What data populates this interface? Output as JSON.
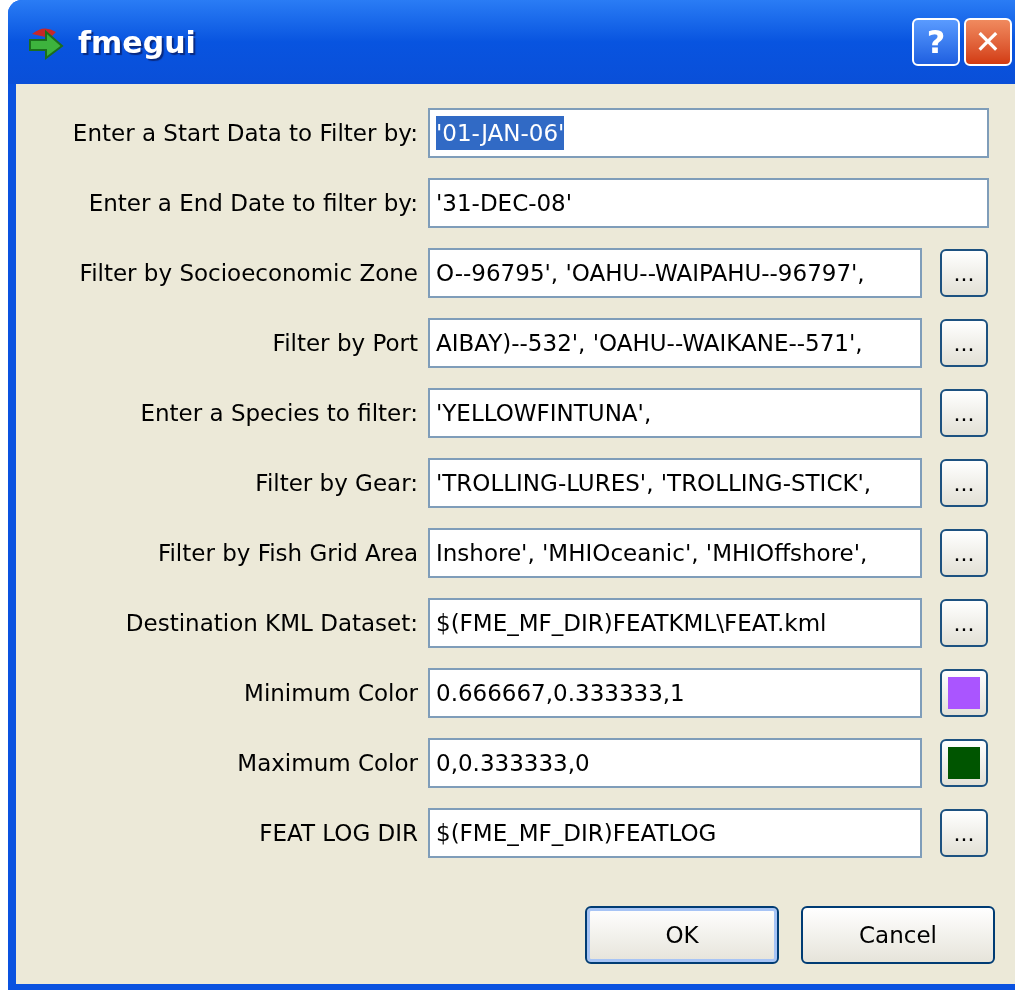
{
  "window": {
    "title": "fmegui"
  },
  "title_buttons": [
    {
      "kind": "help",
      "label": "?"
    },
    {
      "kind": "close",
      "label": "✕"
    }
  ],
  "rows": [
    {
      "label": "Enter a Start Data to Filter by:",
      "value": "'01-JAN-06'",
      "text_selected": true,
      "kind": "text"
    },
    {
      "label": "Enter a End Date to filter by:",
      "value": "'31-DEC-08'",
      "text_selected": false,
      "kind": "text"
    },
    {
      "label": "Filter by Socioeconomic Zone",
      "value": "O--96795', 'OAHU--WAIPAHU--96797',",
      "text_selected": false,
      "kind": "browse",
      "button": "..."
    },
    {
      "label": "Filter by Port",
      "value": "AIBAY)--532', 'OAHU--WAIKANE--571',",
      "text_selected": false,
      "kind": "browse",
      "button": "..."
    },
    {
      "label": "Enter a Species to filter:",
      "value": "'YELLOWFINTUNA',",
      "text_selected": false,
      "kind": "browse",
      "button": "..."
    },
    {
      "label": "Filter by Gear:",
      "value": "'TROLLING-LURES', 'TROLLING-STICK',",
      "text_selected": false,
      "kind": "browse",
      "button": "..."
    },
    {
      "label": "Filter by Fish Grid Area",
      "value": "Inshore', 'MHIOceanic', 'MHIOffshore',",
      "text_selected": false,
      "kind": "browse",
      "button": "..."
    },
    {
      "label": "Destination KML Dataset:",
      "value": "$(FME_MF_DIR)FEATKML\\FEAT.kml",
      "text_selected": false,
      "kind": "browse",
      "button": "..."
    },
    {
      "label": "Minimum Color",
      "value": "0.666667,0.333333,1",
      "text_selected": false,
      "kind": "color",
      "color": "#aa55ff"
    },
    {
      "label": "Maximum Color",
      "value": "0,0.333333,0",
      "text_selected": false,
      "kind": "color",
      "color": "#005500"
    },
    {
      "label": "FEAT LOG DIR",
      "value": "$(FME_MF_DIR)FEATLOG",
      "text_selected": false,
      "kind": "browse",
      "button": "..."
    }
  ],
  "buttons": [
    {
      "label": "OK",
      "default": true
    },
    {
      "label": "Cancel",
      "default": false
    }
  ]
}
